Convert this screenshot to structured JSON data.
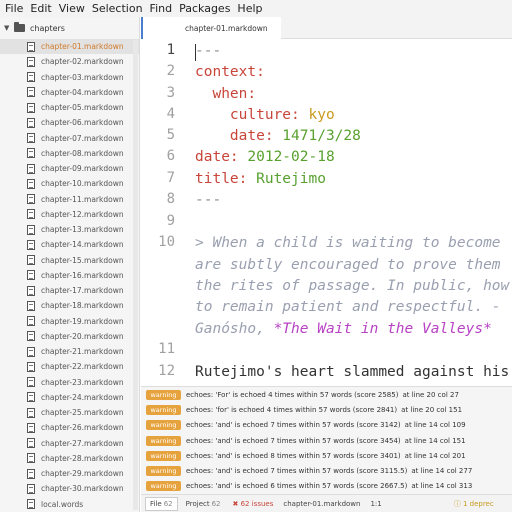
{
  "menu": [
    "File",
    "Edit",
    "View",
    "Selection",
    "Find",
    "Packages",
    "Help"
  ],
  "tree": {
    "root": "chapters",
    "files": [
      "chapter-01.markdown",
      "chapter-02.markdown",
      "chapter-03.markdown",
      "chapter-04.markdown",
      "chapter-05.markdown",
      "chapter-06.markdown",
      "chapter-07.markdown",
      "chapter-08.markdown",
      "chapter-09.markdown",
      "chapter-10.markdown",
      "chapter-11.markdown",
      "chapter-12.markdown",
      "chapter-13.markdown",
      "chapter-14.markdown",
      "chapter-15.markdown",
      "chapter-16.markdown",
      "chapter-17.markdown",
      "chapter-18.markdown",
      "chapter-19.markdown",
      "chapter-20.markdown",
      "chapter-21.markdown",
      "chapter-22.markdown",
      "chapter-23.markdown",
      "chapter-24.markdown",
      "chapter-25.markdown",
      "chapter-26.markdown",
      "chapter-27.markdown",
      "chapter-28.markdown",
      "chapter-29.markdown",
      "chapter-30.markdown",
      "local.words"
    ],
    "selected_index": 0
  },
  "tab": {
    "label": "chapter-01.markdown"
  },
  "editor": {
    "line_numbers": [
      "1",
      "2",
      "3",
      "4",
      "5",
      "6",
      "7",
      "8",
      "9",
      "10",
      "",
      "",
      "",
      "",
      "11",
      "12"
    ],
    "lines": {
      "l1": "---",
      "l2_key": "context:",
      "l3_key": "  when:",
      "l4_key": "    culture:",
      "l4_val": " kyo",
      "l5_key": "    date:",
      "l5_val": " 1471/3/28",
      "l6_key": "date:",
      "l6_val": " 2012-02-18",
      "l7_key": "title:",
      "l7_val": " Rutejimo",
      "l8": "---",
      "l10a": "> When a child is waiting to become",
      "l10b": "are subtly encouraged to prove them",
      "l10c": "the rites of passage. In public, how",
      "l10d": "to remain patient and respectful. -",
      "l10e": "Ganósho, ",
      "l10e_em": "*The Wait in the Valleys*",
      "l12": "Rutejimo's heart slammed against his"
    }
  },
  "linter": {
    "badge": "warning",
    "rows": [
      {
        "msg": "echoes: 'For' is echoed 4 times within 57 words (score 2585)",
        "loc": "at line 20 col 27"
      },
      {
        "msg": "echoes: 'for' is echoed 4 times within 57 words (score 2841)",
        "loc": "at line 20 col 151"
      },
      {
        "msg": "echoes: 'and' is echoed 7 times within 57 words (score 3142)",
        "loc": "at line 14 col 109"
      },
      {
        "msg": "echoes: 'and' is echoed 7 times within 57 words (score 3454)",
        "loc": "at line 14 col 151"
      },
      {
        "msg": "echoes: 'and' is echoed 8 times within 57 words (score 3401)",
        "loc": "at line 14 col 201"
      },
      {
        "msg": "echoes: 'and' is echoed 7 times within 57 words (score 3115.5)",
        "loc": "at line 14 col 277"
      },
      {
        "msg": "echoes: 'and' is echoed 6 times within 57 words (score 2667.5)",
        "loc": "at line 14 col 313"
      }
    ]
  },
  "status": {
    "file_tab": "File",
    "file_count": "62",
    "project_tab": "Project",
    "project_count": "62",
    "issues": "✖ 62 issues",
    "filename": "chapter-01.markdown",
    "position": "1:1",
    "right": "ⓘ 1 deprec"
  },
  "colors": {
    "key": "#c8453a",
    "string": "#c99a1f",
    "date": "#58a12f",
    "badge": "#e6a23c",
    "accent": "#4a7fd0"
  }
}
